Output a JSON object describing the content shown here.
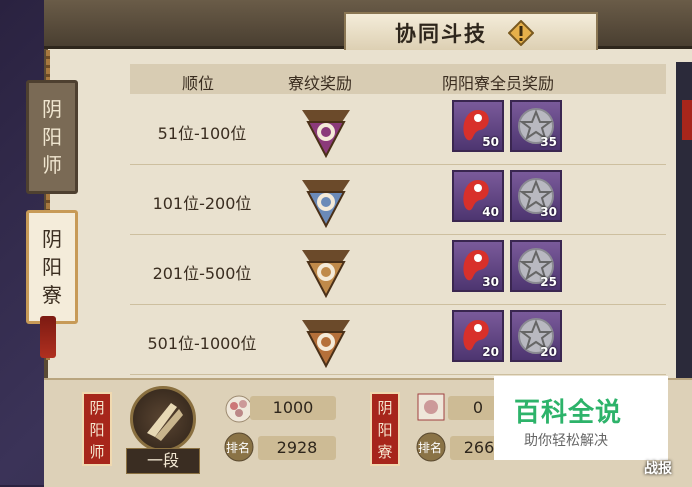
{
  "header": {
    "title": "协同斗技"
  },
  "tabs": [
    {
      "label": "阴阳师",
      "chars": [
        "阴",
        "阳",
        "师"
      ]
    },
    {
      "label": "阴阳寮",
      "chars": [
        "阴",
        "阳",
        "寮"
      ]
    }
  ],
  "table": {
    "columns": [
      "顺位",
      "寮纹奖励",
      "阴阳寮全员奖励"
    ],
    "rows": [
      {
        "rank": "51位-100位",
        "badge_color": "#8b3a7a",
        "reward1": "50",
        "reward2": "35"
      },
      {
        "rank": "101位-200位",
        "badge_color": "#6b8ab8",
        "reward1": "40",
        "reward2": "30"
      },
      {
        "rank": "201位-500位",
        "badge_color": "#c08a4a",
        "reward1": "30",
        "reward2": "25"
      },
      {
        "rank": "501位-1000位",
        "badge_color": "#b5703a",
        "reward1": "20",
        "reward2": "20"
      }
    ]
  },
  "bottom": {
    "player_seal": [
      "阴",
      "阳",
      "师"
    ],
    "player_rank": "一段",
    "player_score": "1000",
    "player_ranking_label": "排名",
    "player_ranking": "2928",
    "guild_seal": [
      "阴",
      "阳",
      "寮"
    ],
    "guild_score": "0",
    "guild_ranking_label": "排名",
    "guild_ranking": "266"
  },
  "watermark": {
    "title": "百科全说",
    "subtitle": "助你轻松解决"
  },
  "battle_report": "战报",
  "colors": {
    "accent": "#a7261b",
    "panel": "#e9e1cf",
    "item_bg": "#5d4080"
  }
}
